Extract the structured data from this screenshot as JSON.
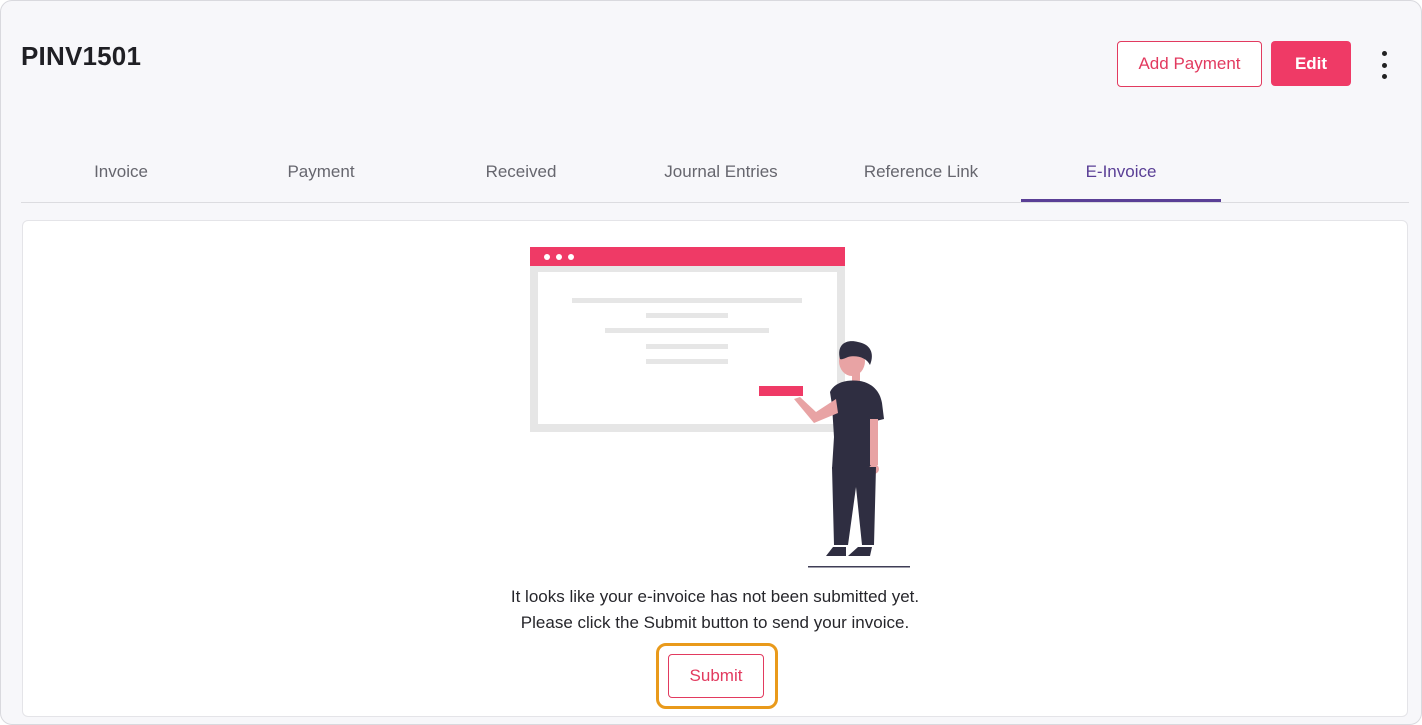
{
  "header": {
    "title": "PINV1501",
    "add_payment_label": "Add Payment",
    "edit_label": "Edit"
  },
  "tabs": [
    {
      "label": "Invoice",
      "active": false
    },
    {
      "label": "Payment",
      "active": false
    },
    {
      "label": "Received",
      "active": false
    },
    {
      "label": "Journal Entries",
      "active": false
    },
    {
      "label": "Reference Link",
      "active": false
    },
    {
      "label": "E-Invoice",
      "active": true
    }
  ],
  "empty_state": {
    "line1": "It looks like your e-invoice has not been submitted yet.",
    "line2": "Please click the Submit button to send your invoice.",
    "submit_label": "Submit"
  },
  "colors": {
    "accent": "#ef3a66",
    "tab_active": "#5a3f96",
    "highlight_ring": "#e99a1b"
  }
}
